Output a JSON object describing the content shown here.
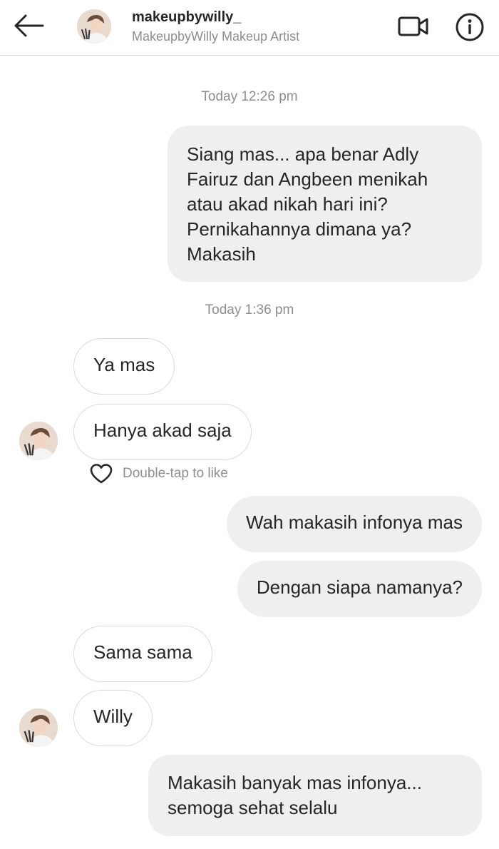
{
  "header": {
    "username": "makeupbywilly_",
    "subtitle": "MakeupbyWilly Makeup Artist",
    "back_icon": "arrow-left-icon",
    "video_icon": "video-call-icon",
    "info_icon": "info-icon"
  },
  "thread": {
    "timestamps": [
      "Today 12:26 pm",
      "Today 1:36 pm"
    ],
    "messages": [
      {
        "from": "me",
        "text": "Siang mas... apa benar Adly Fairuz dan Angbeen menikah atau akad nikah hari ini? Pernikahannya dimana ya? Makasih"
      },
      {
        "from": "them",
        "text": "Ya mas"
      },
      {
        "from": "them",
        "text": "Hanya akad saja"
      },
      {
        "from": "me",
        "text": "Wah makasih infonya mas"
      },
      {
        "from": "me",
        "text": "Dengan siapa namanya?"
      },
      {
        "from": "them",
        "text": "Sama sama"
      },
      {
        "from": "them",
        "text": "Willy"
      },
      {
        "from": "me",
        "text": "Makasih banyak mas infonya... semoga sehat selalu"
      }
    ],
    "like_hint": "Double-tap to like"
  },
  "colors": {
    "sent_bubble": "#efefef",
    "received_border": "#dbdbdb",
    "secondary_text": "#8e8e8e",
    "primary_text": "#262626"
  }
}
